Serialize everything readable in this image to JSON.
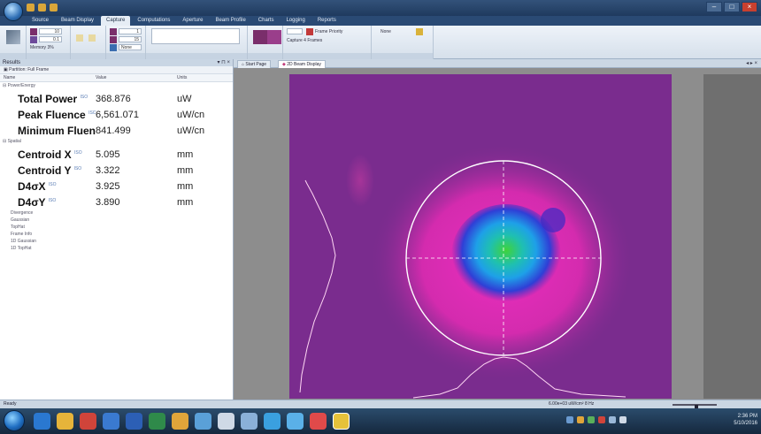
{
  "window": {
    "title": ""
  },
  "ribbon": {
    "tabs": [
      {
        "label": "Source",
        "active": false
      },
      {
        "label": "Beam Display",
        "active": false
      },
      {
        "label": "Capture",
        "active": true
      },
      {
        "label": "Computations",
        "active": false
      },
      {
        "label": "Aperture",
        "active": false
      },
      {
        "label": "Beam Profile",
        "active": false
      },
      {
        "label": "Charts",
        "active": false
      },
      {
        "label": "Logging",
        "active": false
      },
      {
        "label": "Reports",
        "active": false
      }
    ],
    "capture_field_1": "10",
    "capture_field_2": "0.1",
    "memory_label": "Memory 3%",
    "frame_field_1": "1",
    "frame_field_2": "15",
    "frame_field_3": "None",
    "frame_priority": "Frame Priority",
    "none_label": "None",
    "capture_frames": "Capture 4 Frames"
  },
  "results": {
    "panel_title": "Results",
    "partition": "Partition: Full Frame",
    "columns": {
      "name": "Name",
      "value": "Value",
      "units": "Units"
    },
    "power_category": "Power/Energy",
    "spatial_category": "Spatial",
    "rows_power": [
      {
        "name": "Total Power",
        "value": "368.876",
        "unit": "uW"
      },
      {
        "name": "Peak Fluence",
        "value": "6,561.071",
        "unit": "uW/cn"
      },
      {
        "name": "Minimum Fluence",
        "value": "841.499",
        "unit": "uW/cn"
      }
    ],
    "rows_spatial": [
      {
        "name": "Centroid X",
        "value": "5.095",
        "unit": "mm"
      },
      {
        "name": "Centroid Y",
        "value": "3.322",
        "unit": "mm"
      },
      {
        "name": "D4σX",
        "value": "3.925",
        "unit": "mm"
      },
      {
        "name": "D4σY",
        "value": "3.890",
        "unit": "mm"
      }
    ],
    "iso_tag": "ISO",
    "subcategories": [
      "Divergence",
      "Gaussian",
      "TopHat",
      "Frame Info",
      "1D Gaussian",
      "1D TopHat"
    ]
  },
  "doc_tabs": [
    {
      "label": "Start Page",
      "active": false
    },
    {
      "label": "2D Beam Display",
      "active": true
    }
  ],
  "status": {
    "text": "Ready",
    "readout": "6.00e+03 uW/cm²  8 Hz",
    "zoom_level": 0.55
  },
  "clock": {
    "time": "2:36 PM",
    "date": "5/10/2016"
  },
  "colors": {
    "beam_background": "#7a2c8e",
    "beam_peak": "#3fd33a",
    "overlay": "#ffffff"
  }
}
